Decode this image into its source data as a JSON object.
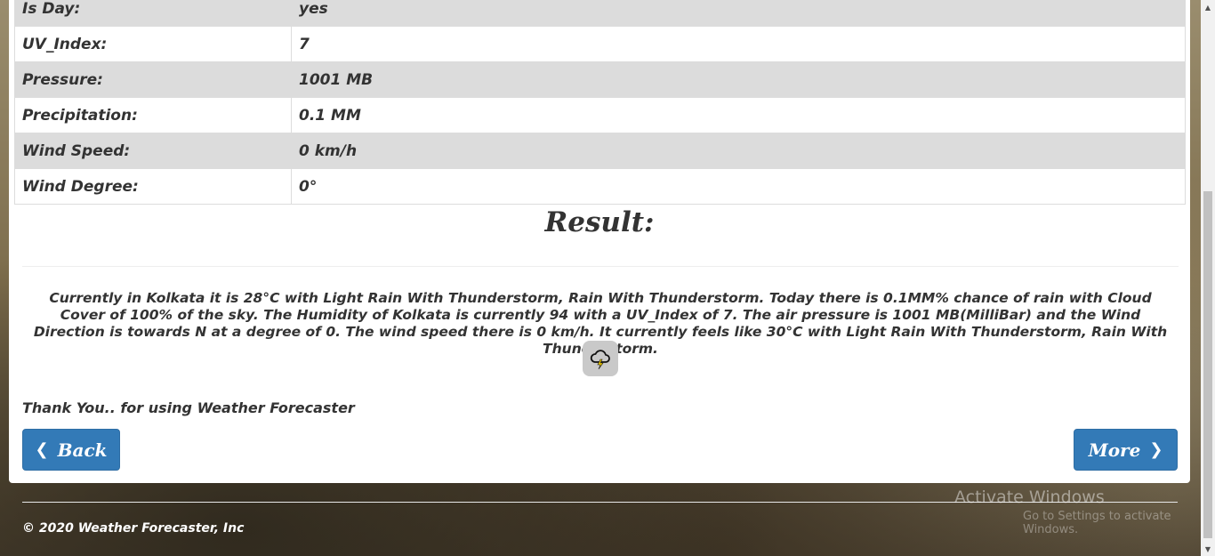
{
  "details": [
    {
      "key": "Is Day:",
      "value": "yes"
    },
    {
      "key": "UV_Index:",
      "value": "7"
    },
    {
      "key": "Pressure:",
      "value": "1001 MB"
    },
    {
      "key": "Precipitation:",
      "value": "0.1 MM"
    },
    {
      "key": "Wind Speed:",
      "value": "0 km/h"
    },
    {
      "key": "Wind Degree:",
      "value": "0°"
    }
  ],
  "result": {
    "title": "Result:",
    "summary": "Currently in Kolkata it is 28°C with Light Rain With Thunderstorm, Rain With Thunderstorm. Today there is 0.1MM% chance of rain with Cloud Cover of 100% of the sky. The Humidity of Kolkata is currently 94 with a UV_Index of 7. The air pressure is 1001 MB(MilliBar) and the Wind Direction is towards N at a degree of 0. The wind speed there is 0 km/h. It currently feels like 30°C with Light Rain With Thunderstorm, Rain With Thunderstorm.",
    "icon": "thunderstorm-icon"
  },
  "thanks": "Thank You.. for using Weather Forecaster",
  "buttons": {
    "back": "Back",
    "more": "More"
  },
  "footer": {
    "copyright": "© 2020 Weather Forecaster, Inc"
  },
  "watermark": {
    "title": "Activate Windows",
    "subtitle": "Go to Settings to activate Windows."
  },
  "colors": {
    "button": "#337ab7",
    "stripe": "#dcdcdc"
  }
}
